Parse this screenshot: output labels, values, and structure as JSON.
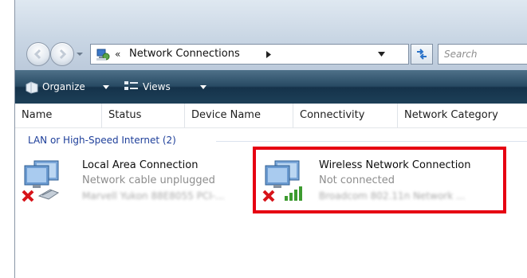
{
  "address": {
    "separator": "«",
    "location": "Network Connections"
  },
  "search": {
    "placeholder": "Search"
  },
  "toolbar": {
    "organize_label": "Organize",
    "views_label": "Views"
  },
  "columns": [
    "Name",
    "Status",
    "Device Name",
    "Connectivity",
    "Network Category"
  ],
  "group": {
    "label": "LAN or High-Speed Internet (2)"
  },
  "connections": [
    {
      "name": "Local Area Connection",
      "status": "Network cable unplugged",
      "device": "Marvell Yukon 88E8055 PCI-..."
    },
    {
      "name": "Wireless Network Connection",
      "status": "Not connected",
      "device": "Broadcom 802.11n Network ..."
    }
  ],
  "colors": {
    "highlight": "#e60012",
    "group_text": "#1e3f9a",
    "toolbar": "#1d4058"
  }
}
